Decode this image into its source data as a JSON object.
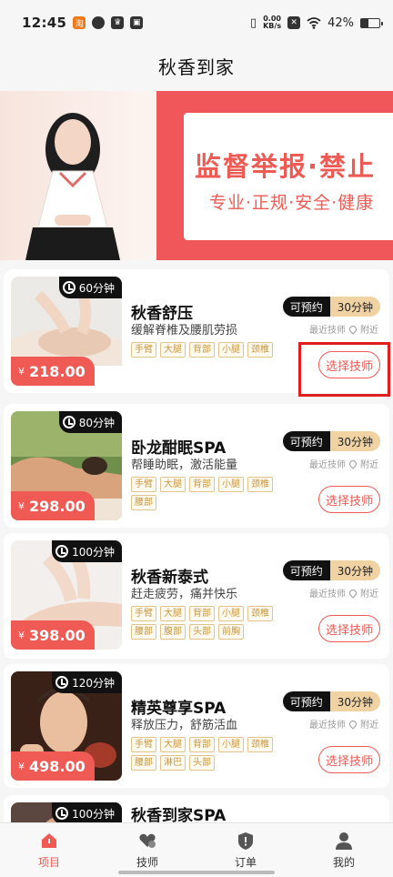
{
  "status_bar": {
    "time": "12:45",
    "net_speed_value": "0.00",
    "net_speed_unit": "KB/s",
    "battery": "42%",
    "battery_level": 0.42
  },
  "header": {
    "title": "秋香到家"
  },
  "banner": {
    "headline": "监督举报·禁止",
    "subline": "专业·正规·安全·健康"
  },
  "colors": {
    "accent": "#ef5a55",
    "tag_gold": "#c7973f",
    "badge_dark": "#111111",
    "badge_gold": "#f1d2a2"
  },
  "services": [
    {
      "name": "秋香舒压",
      "desc": "缓解脊椎及腰肌劳损",
      "duration": "60分钟",
      "price": "218.00",
      "currency": "¥",
      "tags": [
        "手臂",
        "大腿",
        "背部",
        "小腿",
        "颈椎"
      ],
      "available": "可预约",
      "slot": "30分钟",
      "recent": "最近技师",
      "nearby": "附近",
      "button": "选择技师"
    },
    {
      "name": "卧龙酣眠SPA",
      "desc": "帮睡助眠，激活能量",
      "duration": "80分钟",
      "price": "298.00",
      "currency": "¥",
      "tags": [
        "手臂",
        "大腿",
        "背部",
        "小腿",
        "颈椎",
        "腰部"
      ],
      "available": "可预约",
      "slot": "30分钟",
      "recent": "最近技师",
      "nearby": "附近",
      "button": "选择技师"
    },
    {
      "name": "秋香新泰式",
      "desc": "赶走疲劳，痛并快乐",
      "duration": "100分钟",
      "price": "398.00",
      "currency": "¥",
      "tags": [
        "手臂",
        "大腿",
        "背部",
        "小腿",
        "颈椎",
        "腰部",
        "腹部",
        "头部",
        "前胸"
      ],
      "available": "可预约",
      "slot": "30分钟",
      "recent": "最近技师",
      "nearby": "附近",
      "button": "选择技师"
    },
    {
      "name": "精英尊享SPA",
      "desc": "释放压力，舒筋活血",
      "duration": "120分钟",
      "price": "498.00",
      "currency": "¥",
      "tags": [
        "手臂",
        "大腿",
        "背部",
        "小腿",
        "颈椎",
        "腰部",
        "淋巴",
        "头部"
      ],
      "available": "可预约",
      "slot": "30分钟",
      "recent": "最近技师",
      "nearby": "附近",
      "button": "选择技师"
    },
    {
      "name": "秋香到家SPA",
      "duration": "100分钟"
    }
  ],
  "tab_bar": [
    {
      "label": "项目",
      "icon": "home-icon"
    },
    {
      "label": "技师",
      "icon": "heart-hands-icon"
    },
    {
      "label": "订单",
      "icon": "order-shield-icon"
    },
    {
      "label": "我的",
      "icon": "person-icon"
    }
  ]
}
